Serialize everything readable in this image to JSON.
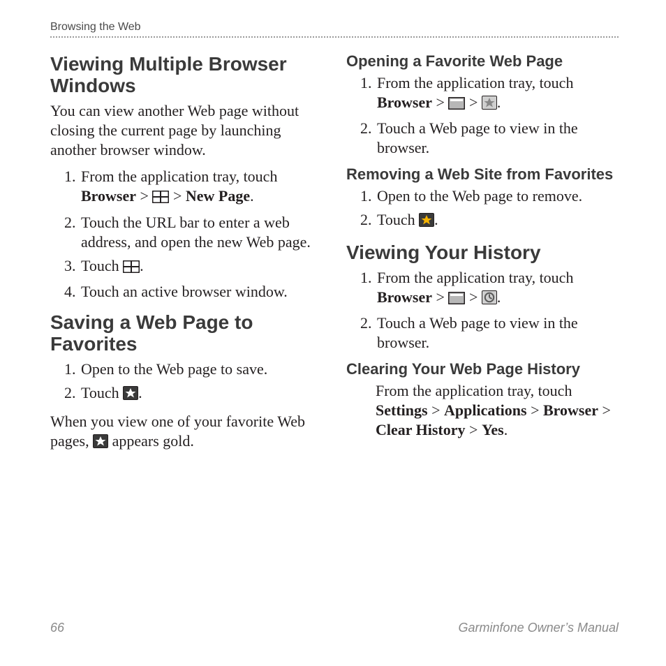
{
  "running_head": "Browsing the Web",
  "left": {
    "h_multiple": "Viewing Multiple Browser Windows",
    "p_multiple": "You can view another Web page without closing the current page by launching another browser window.",
    "steps_multiple": {
      "s1_a": "From the application tray, touch ",
      "s1_b": "Browser",
      "s1_c": "New Page",
      "s2": "Touch the URL bar to enter a web address, and open the new Web page.",
      "s3": "Touch ",
      "s4": "Touch an active browser window."
    },
    "h_saving": "Saving a Web Page to Favorites",
    "steps_saving": {
      "s1": "Open to the Web page to save.",
      "s2": "Touch "
    },
    "p_fav_a": "When you view one of your favorite Web pages, ",
    "p_fav_b": " appears gold."
  },
  "right": {
    "h_opening": "Opening a Favorite Web Page",
    "steps_opening": {
      "s1_a": "From the application tray, touch ",
      "s1_b": "Browser",
      "s2": "Touch a Web page to view in the browser."
    },
    "h_removing": "Removing a Web Site from Favorites",
    "steps_removing": {
      "s1": "Open to the Web page to remove.",
      "s2": "Touch "
    },
    "h_history": "Viewing Your History",
    "steps_history": {
      "s1_a": "From the application tray, touch ",
      "s1_b": "Browser",
      "s2": "Touch a Web page to view in the browser."
    },
    "h_clearing": "Clearing Your Web Page History",
    "p_clearing_a": "From the application tray, touch ",
    "p_clearing_b": "Settings",
    "p_clearing_c": "Applications",
    "p_clearing_d": "Browser",
    "p_clearing_e": "Clear History",
    "p_clearing_f": "Yes"
  },
  "footer": {
    "page_no": "66",
    "manual": "Garminfone Owner’s Manual"
  },
  "gt": " > "
}
